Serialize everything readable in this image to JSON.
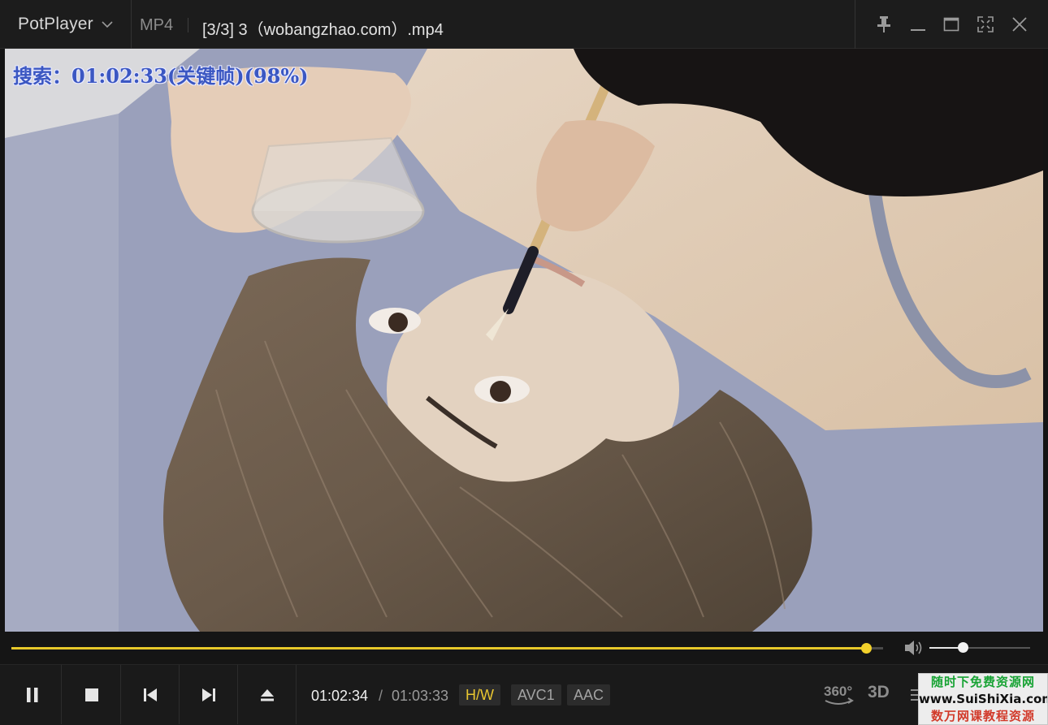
{
  "titlebar": {
    "app_name": "PotPlayer",
    "format": "MP4",
    "file_title": "[3/3] 3（wobangzhao.com）.mp4"
  },
  "window_controls": [
    "pin-icon",
    "minimize-icon",
    "maximize-icon",
    "fullscreen-icon",
    "close-icon"
  ],
  "video": {
    "osd_text": "搜索：01:02:33(关键帧)(98%)"
  },
  "seek": {
    "progress": 0.98,
    "accent_color": "#e8c92a"
  },
  "volume": {
    "level": 0.33
  },
  "playback": {
    "current_time": "01:02:34",
    "separator": "/",
    "total_time": "01:03:33",
    "hw_badge": "H/W",
    "video_codec": "AVC1",
    "audio_codec": "AAC",
    "btn_3d": "3D",
    "btn_360": "360°"
  },
  "controls": [
    "pause-icon",
    "stop-icon",
    "previous-icon",
    "next-icon",
    "eject-icon"
  ],
  "watermark": {
    "line1": "随时下免费资源网",
    "line2": "www.SuiShiXia.com",
    "line3": "数万网课教程资源"
  }
}
